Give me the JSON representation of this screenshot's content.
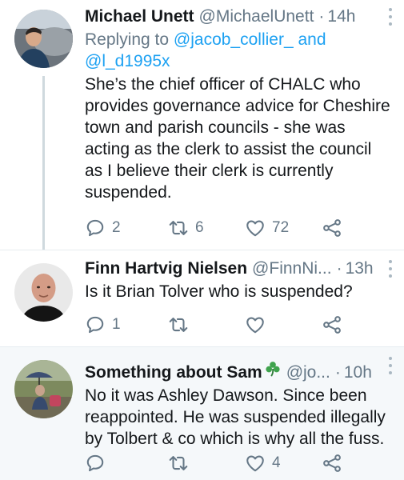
{
  "tweets": [
    {
      "name": "Michael Unett",
      "handle": "@MichaelUnett",
      "dot": "·",
      "time": "14h",
      "replying_prefix": "Replying to",
      "replying_user1": "@jacob_collier_",
      "replying_and": "and",
      "replying_user2": "@l_d1995x",
      "lines": [
        "She’s the chief officer of CHALC who",
        "provides governance advice for Cheshire",
        "town and parish councils - she was",
        "acting as the clerk to assist the council",
        "as I believe their clerk is currently",
        "suspended."
      ],
      "replies": "2",
      "retweets": "6",
      "likes": "72"
    },
    {
      "name": "Finn Hartvig Nielsen",
      "handle": "@FinnNi...",
      "dot": "·",
      "time": "13h",
      "lines": [
        "Is it Brian Tolver who is suspended?"
      ],
      "replies": "1",
      "retweets": "",
      "likes": ""
    },
    {
      "name": "Something about Sam",
      "handle": "@jo...",
      "dot": "·",
      "time": "10h",
      "lines": [
        "No it was Ashley Dawson. Since been",
        "reappointed. He was suspended illegally",
        "by Tolbert & co which is why all the fuss."
      ],
      "replies": "",
      "retweets": "",
      "likes": "4"
    }
  ],
  "icons": {
    "reply": "reply-icon",
    "retweet": "retweet-icon",
    "like": "heart-icon",
    "share": "share-icon",
    "more": "more-vertical-icon",
    "emoji": "shamrock-icon"
  },
  "colors": {
    "link": "#1da1f2",
    "secondary": "#657786",
    "text": "#14171a",
    "highlight_bg": "#f5f8fa",
    "divider": "#e6ecf0",
    "thread_line": "#cfd9de"
  }
}
